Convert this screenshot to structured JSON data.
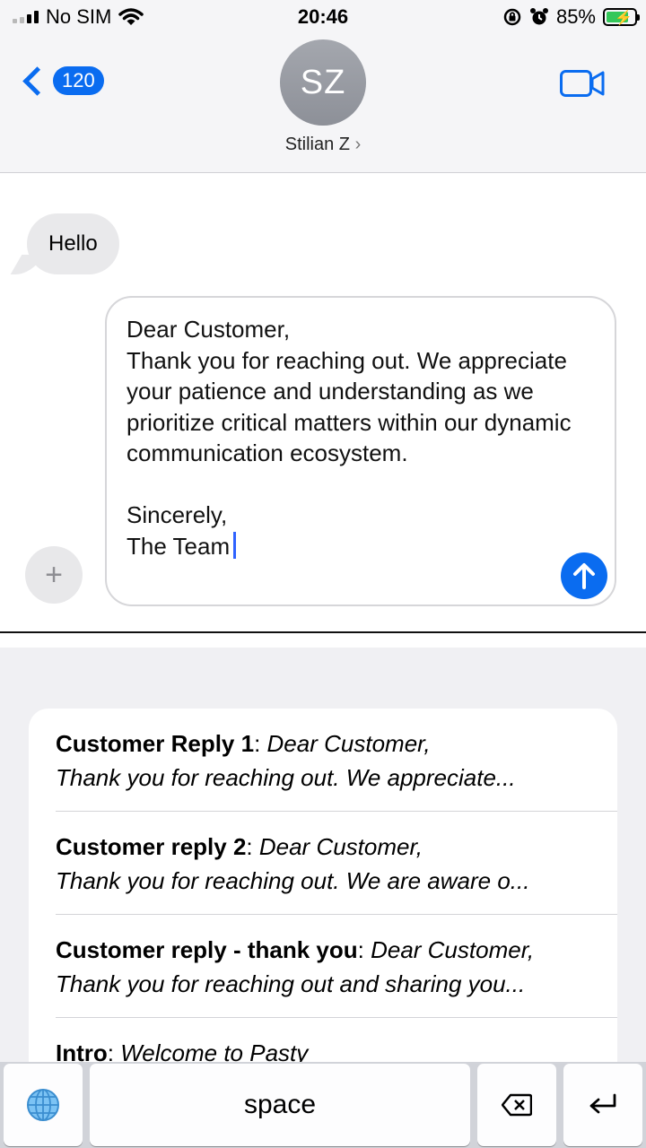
{
  "status_bar": {
    "carrier": "No SIM",
    "time": "20:46",
    "battery_percent": "85%"
  },
  "header": {
    "back_count": "120",
    "avatar_initials": "SZ",
    "contact_name": "Stilian Z",
    "accent_color": "#0a6cf0"
  },
  "conversation": {
    "incoming_message": "Hello",
    "compose_text": "Dear Customer,\nThank you for reaching out. We appreciate your patience and understanding as we prioritize critical matters within our dynamic communication ecosystem.\n\nSincerely,\nThe Team"
  },
  "snippets": [
    {
      "title": "Customer Reply 1",
      "preview_line1": "Dear Customer,",
      "preview_line2": "Thank you for reaching out. We appreciate..."
    },
    {
      "title": "Customer reply 2",
      "preview_line1": "Dear Customer,",
      "preview_line2": "Thank you for reaching out. We are aware o..."
    },
    {
      "title": "Customer reply - thank you",
      "preview_line1": "Dear Customer,",
      "preview_line2": "Thank you for reaching out and sharing you..."
    },
    {
      "title": "Intro",
      "preview_line1": "Welcome to Pasty"
    }
  ],
  "keyboard": {
    "space_label": "space"
  }
}
